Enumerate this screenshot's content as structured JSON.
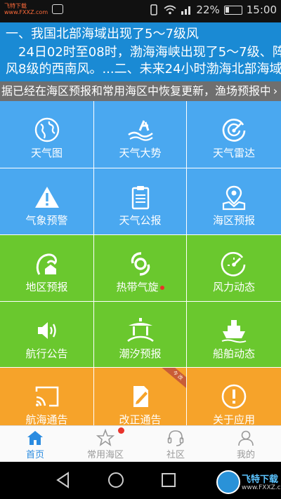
{
  "status_bar": {
    "source_tag_line1": "飞特下载",
    "source_tag_line2": "www.FXXZ.com",
    "signal_text": "22%",
    "time": "15:00"
  },
  "banner": {
    "line1": "一、我国北部海域出现了5～7级风",
    "line2": "24日02时至08时，渤海海峡出现了5～7级、阵",
    "line3": "风8级的西南风。...二、未来24小时渤海北部海域"
  },
  "notice": {
    "text": "据已经在海区预报和常用海区中恢复更新，渔场预报中以",
    "arrow": "›"
  },
  "tiles": [
    {
      "label": "天气图",
      "icon": "globe-icon",
      "color": "blue"
    },
    {
      "label": "天气大势",
      "icon": "wave-logo-icon",
      "color": "blue"
    },
    {
      "label": "天气雷达",
      "icon": "radar-icon",
      "color": "blue"
    },
    {
      "label": "气象预警",
      "icon": "warning-icon",
      "color": "blue"
    },
    {
      "label": "天气公报",
      "icon": "clipboard-icon",
      "color": "blue"
    },
    {
      "label": "海区预报",
      "icon": "map-pin-icon",
      "color": "blue"
    },
    {
      "label": "地区预报",
      "icon": "wave-house-icon",
      "color": "green"
    },
    {
      "label": "热带气旋",
      "icon": "typhoon-icon",
      "color": "green"
    },
    {
      "label": "风力动态",
      "icon": "gauge-icon",
      "color": "green"
    },
    {
      "label": "航行公告",
      "icon": "speaker-icon",
      "color": "green"
    },
    {
      "label": "潮汐预报",
      "icon": "pavilion-icon",
      "color": "green"
    },
    {
      "label": "船舶动态",
      "icon": "ship-icon",
      "color": "green"
    },
    {
      "label": "航海通告",
      "icon": "cast-icon",
      "color": "orange"
    },
    {
      "label": "改正通告",
      "icon": "edit-doc-icon",
      "color": "orange",
      "ribbon": "今 改"
    },
    {
      "label": "关于应用",
      "icon": "info-icon",
      "color": "orange"
    }
  ],
  "colors": {
    "banner": "#1a8ad4",
    "notice": "#6f6f6f",
    "blue": "#4aa8f0",
    "green": "#6ac82e",
    "orange": "#f6a32a",
    "tab_active": "#2a8be0",
    "badge": "#e8322a"
  },
  "tabs": [
    {
      "label": "首页",
      "icon": "home-icon",
      "active": true
    },
    {
      "label": "常用海区",
      "icon": "star-icon",
      "active": false
    },
    {
      "label": "社区",
      "icon": "headset-icon",
      "active": false
    },
    {
      "label": "我的",
      "icon": "user-icon",
      "active": false
    }
  ],
  "watermark": {
    "title": "飞特下载",
    "sub": "www.FXXZ.com"
  }
}
